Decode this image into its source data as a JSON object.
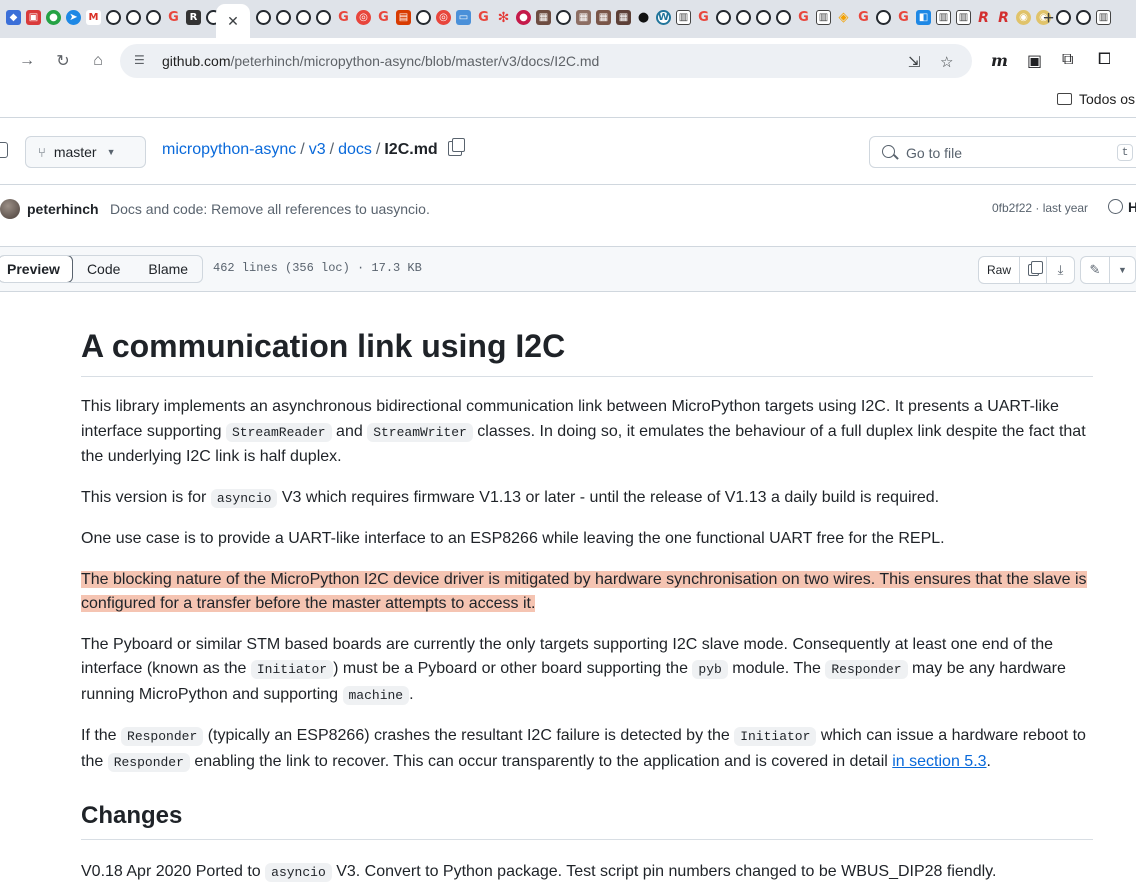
{
  "browser": {
    "url_host": "github.com",
    "url_path": "/peterhinch/micropython-async/blob/master/v3/docs/I2C.md",
    "bookmark_folder": "Todos os"
  },
  "repo": {
    "branch": "master",
    "crumbs": [
      "micropython-async",
      "v3",
      "docs"
    ],
    "file": "I2C.md",
    "goto_placeholder": "Go to file",
    "goto_key": "t"
  },
  "commit": {
    "author": "peterhinch",
    "message": "Docs and code: Remove all references to uasyncio.",
    "meta": "0fb2f22 · last year",
    "history": "H"
  },
  "toolbar": {
    "tabs": [
      "Preview",
      "Code",
      "Blame"
    ],
    "info": "462 lines (356 loc) · 17.3 KB",
    "raw": "Raw"
  },
  "doc": {
    "title": "A communication link using I2C",
    "p1_a": "This library implements an asynchronous bidirectional communication link between MicroPython targets using I2C. It presents a UART-like interface supporting ",
    "p1_code1": "StreamReader",
    "p1_b": " and ",
    "p1_code2": "StreamWriter",
    "p1_c": " classes. In doing so, it emulates the behaviour of a full duplex link despite the fact that the underlying I2C link is half duplex.",
    "p2_a": "This version is for ",
    "p2_code": "asyncio",
    "p2_b": " V3 which requires firmware V1.13 or later - until the release of V1.13 a daily build is required.",
    "p3": "One use case is to provide a UART-like interface to an ESP8266 while leaving the one functional UART free for the REPL.",
    "p4": "The blocking nature of the MicroPython I2C device driver is mitigated by hardware synchronisation on two wires. This ensures that the slave is configured for a transfer before the master attempts to access it.",
    "p5_a": "The Pyboard or similar STM based boards are currently the only targets supporting I2C slave mode. Consequently at least one end of the interface (known as the ",
    "p5_code1": "Initiator",
    "p5_b": ") must be a Pyboard or other board supporting the ",
    "p5_code2": "pyb",
    "p5_c": " module. The ",
    "p5_code3": "Responder",
    "p5_d": " may be any hardware running MicroPython and supporting ",
    "p5_code4": "machine",
    "p5_e": ".",
    "p6_a": "If the ",
    "p6_code1": "Responder",
    "p6_b": " (typically an ESP8266) crashes the resultant I2C failure is detected by the ",
    "p6_code2": "Initiator",
    "p6_c": " which can issue a hardware reboot to the ",
    "p6_code3": "Responder",
    "p6_d": " enabling the link to recover. This can occur transparently to the application and is covered in detail ",
    "p6_link": "in section 5.3",
    "p6_e": ".",
    "h2": "Changes",
    "p7_a": "V0.18 Apr 2020 Ported to ",
    "p7_code": "asyncio",
    "p7_b": " V3. Convert to Python package. Test script pin numbers changed to be WBUS_DIP28 fiendly."
  }
}
